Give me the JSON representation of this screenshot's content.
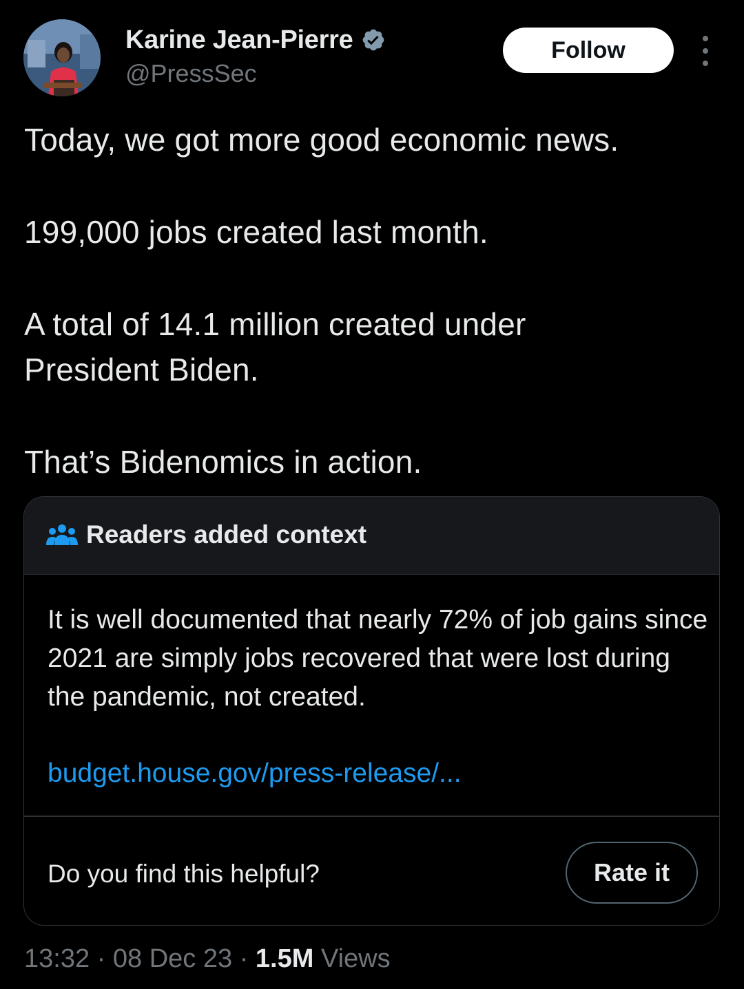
{
  "author": {
    "display_name": "Karine Jean-Pierre",
    "handle": "@PressSec",
    "verified": true,
    "verified_badge_color": "#829aab",
    "avatar_icon": "profile-photo"
  },
  "actions": {
    "follow_label": "Follow",
    "more_icon": "more-vertical-icon"
  },
  "tweet": {
    "paragraphs": [
      "Today, we got more good economic news.",
      "199,000 jobs created last month.",
      "A total of 14.1 million created under\nPresident Biden.",
      "That’s Bidenomics in action."
    ]
  },
  "community_note": {
    "title": "Readers added context",
    "icon": "readers-icon",
    "body": "It is well documented that nearly 72% of job gains since 2021 are simply jobs recovered that were lost during the pandemic, not created.",
    "link_text": "budget.house.gov/press-release/...",
    "helpful_question": "Do you find this helpful?",
    "rate_label": "Rate it"
  },
  "meta": {
    "time": "13:32",
    "separator": "·",
    "date": "08 Dec 23",
    "views_count": "1.5M",
    "views_label": "Views"
  },
  "colors": {
    "background": "#000000",
    "text_primary": "#e7e9ea",
    "text_secondary": "#71767b",
    "link": "#1d9bf0",
    "border": "#2f3336",
    "note_header_bg": "#16181c"
  }
}
